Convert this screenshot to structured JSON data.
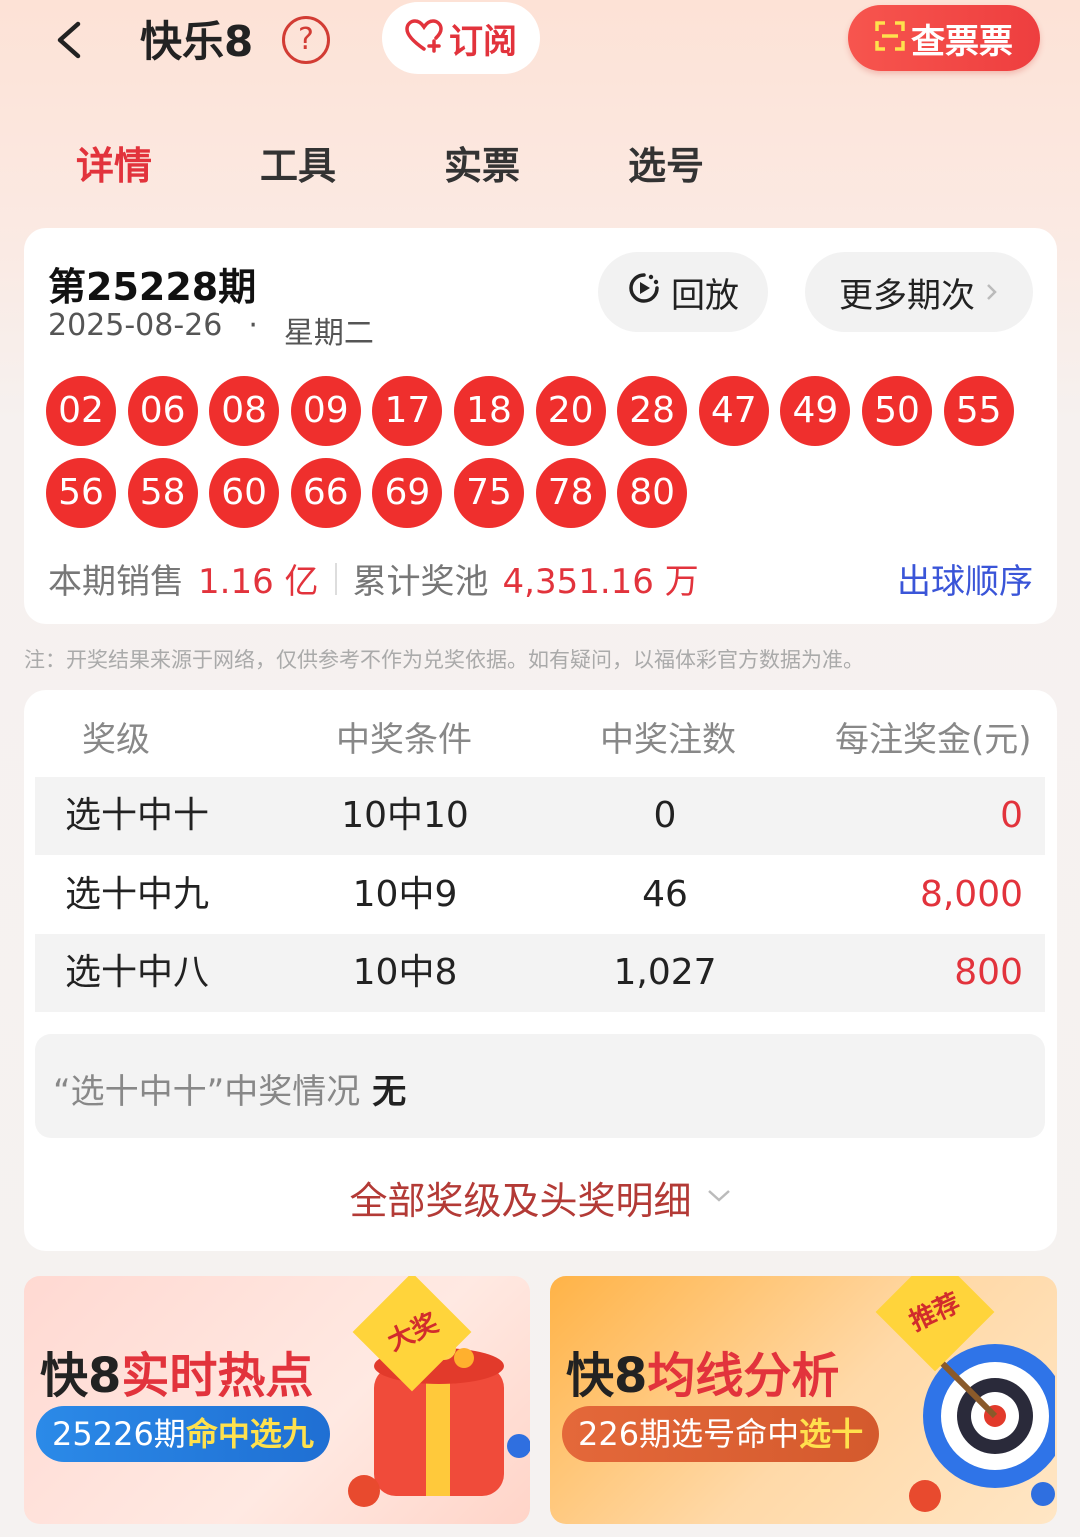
{
  "header": {
    "title": "快乐8",
    "help_label": "?",
    "subscribe_label": "订阅",
    "check_ticket_label": "查票票"
  },
  "tabs": [
    {
      "label": "详情",
      "active": true
    },
    {
      "label": "工具",
      "active": false
    },
    {
      "label": "实票",
      "active": false
    },
    {
      "label": "选号",
      "active": false
    }
  ],
  "draw": {
    "period": "第25228期",
    "date": "2025-08-26",
    "separator": "·",
    "weekday": "星期二",
    "replay_label": "回放",
    "more_label": "更多期次",
    "numbers": [
      "02",
      "06",
      "08",
      "09",
      "17",
      "18",
      "20",
      "28",
      "47",
      "49",
      "50",
      "55",
      "56",
      "58",
      "60",
      "66",
      "69",
      "75",
      "78",
      "80"
    ],
    "sales_label": "本期销售",
    "sales_value": "1.16 亿",
    "pool_label": "累计奖池",
    "pool_value": "4,351.16 万",
    "order_link": "出球顺序"
  },
  "note": "注：开奖结果来源于网络，仅供参考不作为兑奖依据。如有疑问，以福体彩官方数据为准。",
  "prize_table": {
    "headers": [
      "奖级",
      "中奖条件",
      "中奖注数",
      "每注奖金(元)"
    ],
    "rows": [
      {
        "level": "选十中十",
        "condition": "10中10",
        "count": "0",
        "amount": "0"
      },
      {
        "level": "选十中九",
        "condition": "10中9",
        "count": "46",
        "amount": "8,000"
      },
      {
        "level": "选十中八",
        "condition": "10中8",
        "count": "1,027",
        "amount": "800"
      }
    ],
    "status_label": "“选十中十”中奖情况",
    "status_value": "无",
    "all_prizes_label": "全部奖级及头奖明细"
  },
  "banners": [
    {
      "title_prefix": "快8",
      "title_highlight": "实时热点",
      "sub_prefix": "25226期",
      "sub_highlight": "命中选九",
      "tag": "大奖"
    },
    {
      "title_prefix": "快8",
      "title_highlight": "均线分析",
      "sub_prefix": "226期选号命中",
      "sub_highlight": "选十",
      "tag": "推荐"
    }
  ],
  "colors": {
    "accent_red": "#e2333c",
    "ball_red": "#ef2f2d",
    "link_blue": "#3a55d8"
  }
}
